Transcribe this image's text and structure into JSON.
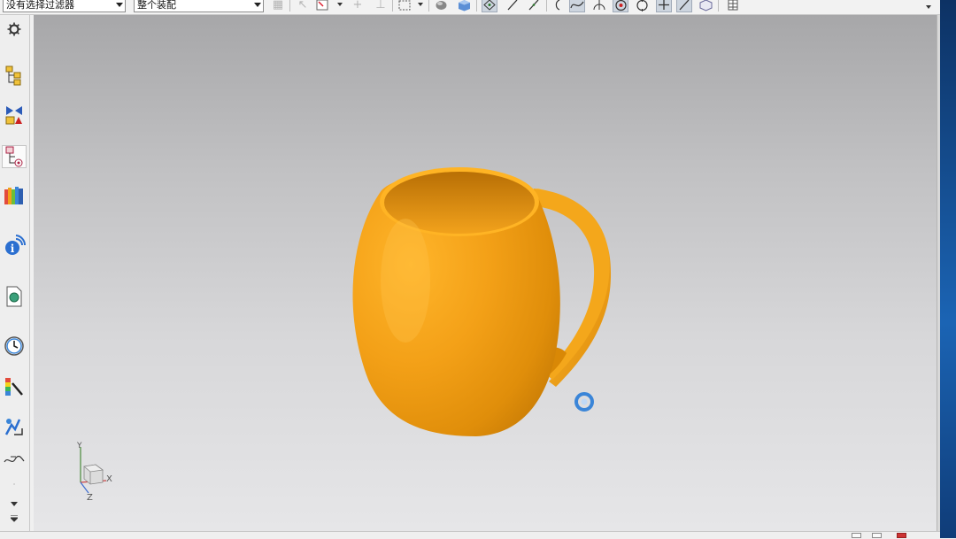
{
  "toolbar": {
    "selection_filter": "没有选择过滤器",
    "selection_scope": "整个装配",
    "icons": [
      "snap-icon",
      "select-icon",
      "arrow-icon",
      "add-icon",
      "rectangle-select-icon",
      "shaded-view-icon",
      "cube-view-icon",
      "snap-point-icon",
      "line-icon",
      "curve-icon",
      "arc-icon",
      "spline-icon",
      "normal-icon",
      "center-point-icon",
      "circle-icon",
      "plus-icon",
      "slash-icon",
      "layer-icon",
      "grid-icon"
    ]
  },
  "sidebar": {
    "items": [
      {
        "name": "settings",
        "icon": "gear-icon"
      },
      {
        "name": "assembly-navigator",
        "icon": "assembly-navigator-icon"
      },
      {
        "name": "constraint-navigator",
        "icon": "constraint-navigator-icon"
      },
      {
        "name": "part-navigator",
        "icon": "part-navigator-icon",
        "active": true
      },
      {
        "name": "reuse-library",
        "icon": "library-icon"
      },
      {
        "name": "hd3d-tools",
        "icon": "info-icon"
      },
      {
        "name": "web-browser",
        "icon": "web-browser-icon"
      },
      {
        "name": "history",
        "icon": "clock-icon"
      },
      {
        "name": "system-materials",
        "icon": "palette-icon"
      },
      {
        "name": "process-studio",
        "icon": "process-studio-icon"
      },
      {
        "name": "roles",
        "icon": "roles-icon"
      }
    ]
  },
  "viewport": {
    "model": "mug",
    "model_color": "#f2a11a",
    "axes": {
      "x": "X",
      "y": "Y",
      "z": "Z"
    }
  },
  "colors": {
    "viewport_top": "#a7a7a9",
    "viewport_bottom": "#e6e6e8",
    "accent": "#3a85d8"
  }
}
